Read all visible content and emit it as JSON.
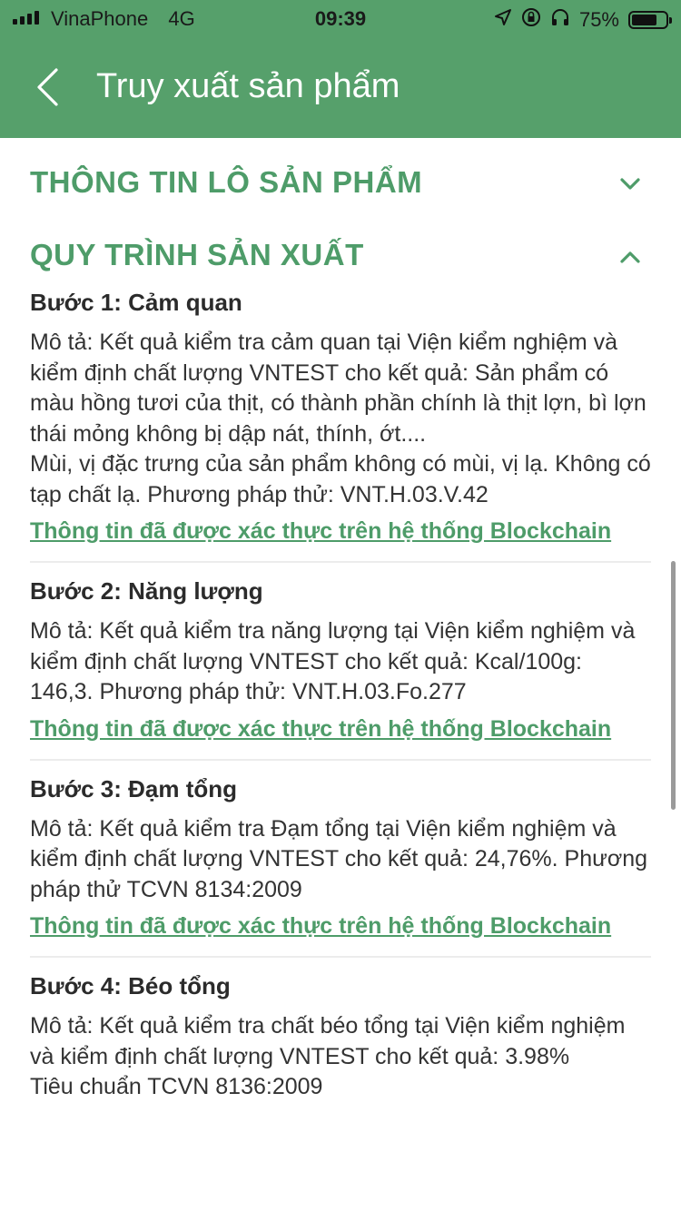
{
  "status_bar": {
    "carrier": "VinaPhone",
    "network": "4G",
    "time": "09:39",
    "battery_text": "75%",
    "battery_level": 0.75
  },
  "nav": {
    "title": "Truy xuất sản phẩm"
  },
  "sections": [
    {
      "title": "THÔNG TIN LÔ SẢN PHẨM",
      "expanded": false
    },
    {
      "title": "QUY TRÌNH SẢN XUẤT",
      "expanded": true
    }
  ],
  "steps": [
    {
      "title": "Bước 1: Cảm quan",
      "description": "Mô tả: Kết quả kiểm tra cảm quan tại Viện kiểm nghiệm và kiểm định chất lượng VNTEST cho kết quả: Sản phẩm có màu hồng tươi của thịt, có thành phần chính là thịt lợn, bì lợn thái mỏng không bị dập nát, thính, ớt....\nMùi, vị đặc trưng của sản phẩm không có mùi, vị lạ. Không có tạp chất lạ. Phương pháp thử: VNT.H.03.V.42",
      "link": "Thông tin đã được xác thực trên hệ thống Blockchain"
    },
    {
      "title": "Bước 2: Năng lượng",
      "description": "Mô tả: Kết quả kiểm tra năng lượng tại Viện kiểm nghiệm và kiểm định chất lượng VNTEST cho kết quả: Kcal/100g: 146,3. Phương pháp thử: VNT.H.03.Fo.277",
      "link": "Thông tin đã được xác thực trên hệ thống Blockchain"
    },
    {
      "title": "Bước 3: Đạm tổng",
      "description": "Mô tả: Kết quả kiểm tra Đạm tổng tại Viện kiểm nghiệm và kiểm định chất lượng VNTEST cho kết quả: 24,76%. Phương pháp thử TCVN 8134:2009",
      "link": "Thông tin đã được xác thực trên hệ thống Blockchain"
    },
    {
      "title": "Bước 4: Béo tổng",
      "description": "Mô tả: Kết quả kiểm tra chất béo tổng tại Viện kiểm nghiệm và kiểm định chất lượng VNTEST cho kết quả: 3.98%\nTiêu chuẩn TCVN 8136:2009",
      "link": ""
    }
  ]
}
